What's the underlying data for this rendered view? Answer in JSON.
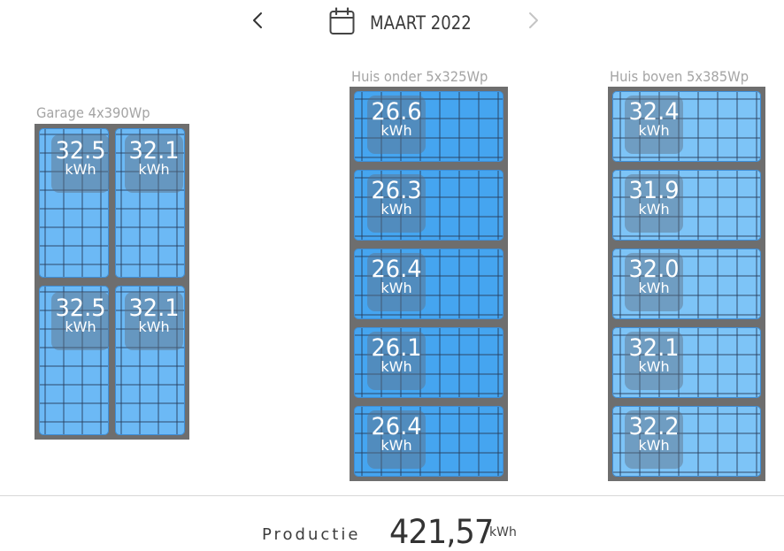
{
  "header": {
    "month": "MAART 2022",
    "prev_icon": "chevron-left-icon",
    "next_icon": "chevron-right-icon",
    "calendar_icon": "calendar-icon"
  },
  "groups": {
    "garage": {
      "label": "Garage 4x390Wp",
      "panels": [
        {
          "value": "32.5",
          "unit": "kWh"
        },
        {
          "value": "32.1",
          "unit": "kWh"
        },
        {
          "value": "32.5",
          "unit": "kWh"
        },
        {
          "value": "32.1",
          "unit": "kWh"
        }
      ]
    },
    "huis_onder": {
      "label": "Huis onder 5x325Wp",
      "panels": [
        {
          "value": "26.6",
          "unit": "kWh"
        },
        {
          "value": "26.3",
          "unit": "kWh"
        },
        {
          "value": "26.4",
          "unit": "kWh"
        },
        {
          "value": "26.1",
          "unit": "kWh"
        },
        {
          "value": "26.4",
          "unit": "kWh"
        }
      ]
    },
    "huis_boven": {
      "label": "Huis boven 5x385Wp",
      "panels": [
        {
          "value": "32.4",
          "unit": "kWh"
        },
        {
          "value": "31.9",
          "unit": "kWh"
        },
        {
          "value": "32.0",
          "unit": "kWh"
        },
        {
          "value": "32.1",
          "unit": "kWh"
        },
        {
          "value": "32.2",
          "unit": "kWh"
        }
      ]
    }
  },
  "footer": {
    "label": "Productie",
    "total": "421,57",
    "unit": "kWh"
  },
  "colors": {
    "panel_light": "#6cb9f5",
    "panel_dark": "#45a5f0",
    "frame": "#6e6e6e",
    "badge": "#5f6e80"
  }
}
